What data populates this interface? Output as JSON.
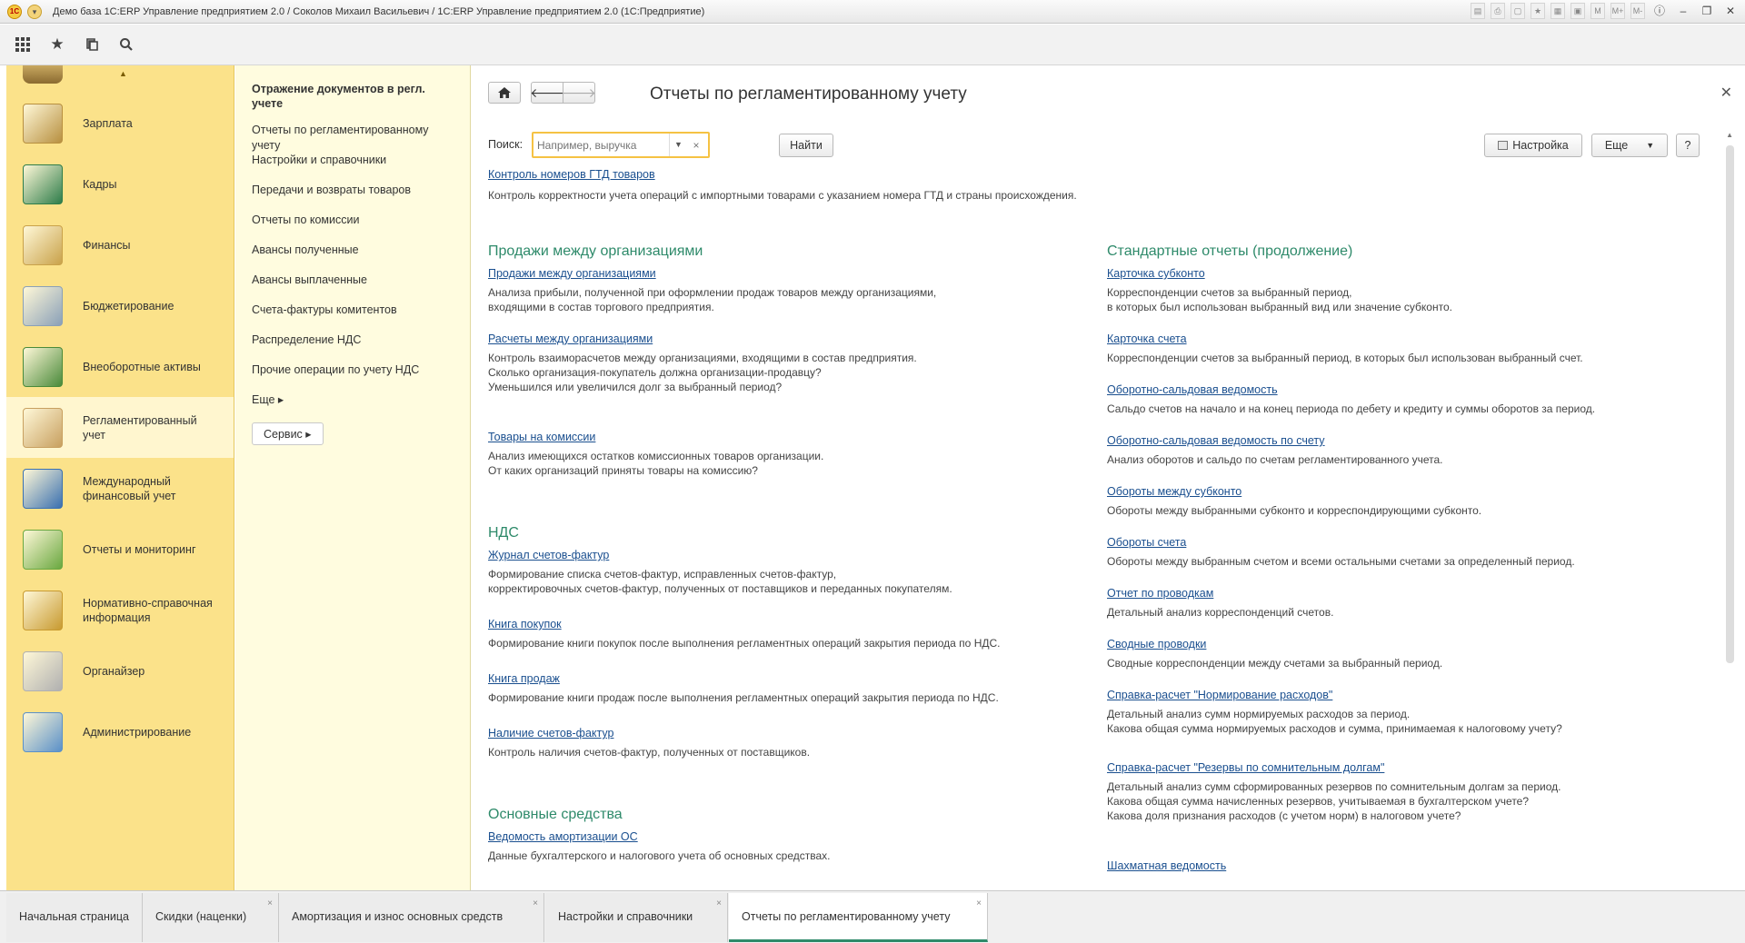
{
  "window": {
    "title": "Демо база 1С:ERP Управление предприятием 2.0 / Соколов Михаил Васильевич / 1С:ERP Управление предприятием 2.0  (1С:Предприятие)"
  },
  "sections": [
    {
      "label": "Зарплата",
      "icon": "salary-icon",
      "color": "#b89040"
    },
    {
      "label": "Кадры",
      "icon": "personnel-icon",
      "color": "#2e7d4a"
    },
    {
      "label": "Финансы",
      "icon": "coins-icon",
      "color": "#c9a24a"
    },
    {
      "label": "Бюджетирование",
      "icon": "budget-icon",
      "color": "#8aa0b8"
    },
    {
      "label": "Внеоборотные активы",
      "icon": "fixed-assets-icon",
      "color": "#4a8a3a"
    },
    {
      "label": "Регламентированный учет",
      "icon": "regulated-accounting-icon",
      "color": "#c8a060"
    },
    {
      "label": "Международный финансовый учет",
      "icon": "international-finance-icon",
      "color": "#3a70b0"
    },
    {
      "label": "Отчеты и мониторинг",
      "icon": "reports-chart-icon",
      "color": "#6aa840"
    },
    {
      "label": "Нормативно-справочная информация",
      "icon": "reference-books-icon",
      "color": "#c89a30"
    },
    {
      "label": "Органайзер",
      "icon": "organizer-icon",
      "color": "#b0b0b0"
    },
    {
      "label": "Администрирование",
      "icon": "administration-icon",
      "color": "#5a90c8"
    }
  ],
  "panel": {
    "title": "Отражение документов в регл. учете",
    "items": [
      "Отчеты по регламентированному учету",
      "Настройки и справочники",
      "Передачи и возвраты товаров",
      "Отчеты по комиссии",
      "Авансы полученные",
      "Авансы выплаченные",
      "Счета-фактуры комитентов",
      "Распределение НДС",
      "Прочие операции по учету НДС"
    ],
    "more": "Еще ▸",
    "service": "Сервис ▸"
  },
  "main": {
    "title": "Отчеты по регламентированному учету",
    "search_label": "Поиск:",
    "search_placeholder": "Например, выручка",
    "find_button": "Найти",
    "settings_button": "Настройка",
    "more_button": "Еще",
    "help_button": "?",
    "top_link": "Контроль номеров ГТД товаров",
    "top_desc": "Контроль корректности учета операций с импортными товарами с указанием номера ГТД и страны происхождения.",
    "left_groups": [
      {
        "title": "Продажи между организациями",
        "reports": [
          {
            "name": "Продажи между организациями",
            "desc": [
              "Анализа прибыли, полученной при оформлении продаж товаров между организациями,",
              "входящими в состав торгового предприятия."
            ]
          },
          {
            "name": "Расчеты между организациями",
            "desc": [
              "Контроль взаиморасчетов между организациями, входящими в состав предприятия.",
              "Сколько организация-покупатель должна организации-продавцу?",
              "Уменьшился или увеличился долг за выбранный период?"
            ]
          },
          {
            "name": "Товары на комиссии",
            "desc": [
              "Анализ имеющихся остатков комиссионных товаров организации.",
              "От каких организаций приняты товары на комиссию?"
            ]
          }
        ]
      },
      {
        "title": "НДС",
        "reports": [
          {
            "name": "Журнал счетов-фактур",
            "desc": [
              "Формирование списка счетов-фактур, исправленных счетов-фактур,",
              "корректировочных счетов-фактур, полученных от поставщиков и переданных покупателям."
            ]
          },
          {
            "name": "Книга покупок",
            "desc": [
              "Формирование книги покупок после выполнения регламентных операций закрытия периода по НДС."
            ]
          },
          {
            "name": "Книга продаж",
            "desc": [
              "Формирование книги продаж после выполнения регламентных операций закрытия периода по НДС."
            ]
          },
          {
            "name": "Наличие счетов-фактур",
            "desc": [
              "Контроль наличия счетов-фактур, полученных от поставщиков."
            ]
          }
        ]
      },
      {
        "title": "Основные средства",
        "reports": [
          {
            "name": "Ведомость амортизации ОС",
            "desc": [
              "Данные бухгалтерского и налогового учета об основных средствах."
            ]
          }
        ]
      }
    ],
    "right_group": {
      "title": "Стандартные отчеты (продолжение)",
      "reports": [
        {
          "name": "Карточка субконто",
          "desc": [
            "Корреспонденции счетов за выбранный период,",
            "в которых был использован выбранный вид  или значение субконто."
          ]
        },
        {
          "name": "Карточка счета",
          "desc": [
            "Корреспонденции счетов за выбранный период, в которых был использован выбранный счет."
          ]
        },
        {
          "name": "Оборотно-сальдовая ведомость",
          "desc": [
            "Сальдо счетов на начало и на конец периода по дебету и кредиту и суммы оборотов за период."
          ]
        },
        {
          "name": "Оборотно-сальдовая ведомость по счету",
          "desc": [
            "Анализ оборотов и сальдо по счетам регламентированного учета."
          ]
        },
        {
          "name": "Обороты между субконто",
          "desc": [
            "Обороты между выбранными субконто и корреспондирующими субконто."
          ]
        },
        {
          "name": "Обороты счета",
          "desc": [
            "Обороты между выбранным счетом и всеми остальными счетами за определенный период."
          ]
        },
        {
          "name": "Отчет по проводкам",
          "desc": [
            "Детальный анализ корреспонденций счетов."
          ]
        },
        {
          "name": "Сводные проводки",
          "desc": [
            "Сводные корреспонденции между счетами за выбранный период."
          ]
        },
        {
          "name": "Справка-расчет \"Нормирование расходов\"",
          "desc": [
            "Детальный анализ сумм нормируемых расходов за период.",
            "Какова общая сумма нормируемых расходов и сумма, принимаемая к налоговому учету?"
          ]
        },
        {
          "name": "Справка-расчет \"Резервы по сомнительным долгам\"",
          "desc": [
            "Детальный анализ сумм сформированных резервов по сомнительным долгам за период.",
            "Какова общая сумма начисленных резервов, учитываемая в бухгалтерском учете?",
            "Какова доля признания расходов (с учетом норм) в налоговом учете?"
          ]
        },
        {
          "name": "Шахматная ведомость",
          "desc": []
        }
      ]
    }
  },
  "tabs": [
    {
      "label": "Начальная страница"
    },
    {
      "label": "Скидки (наценки)"
    },
    {
      "label": "Амортизация и износ основных средств"
    },
    {
      "label": "Настройки и справочники"
    },
    {
      "label": "Отчеты по регламентированному учету"
    }
  ],
  "colors": {
    "sections_bg": "#fbe28a",
    "panel_bg": "#fffcdf",
    "group_title": "#2e8a6a",
    "link": "#1a4f8f",
    "search_border": "#f5c243"
  }
}
